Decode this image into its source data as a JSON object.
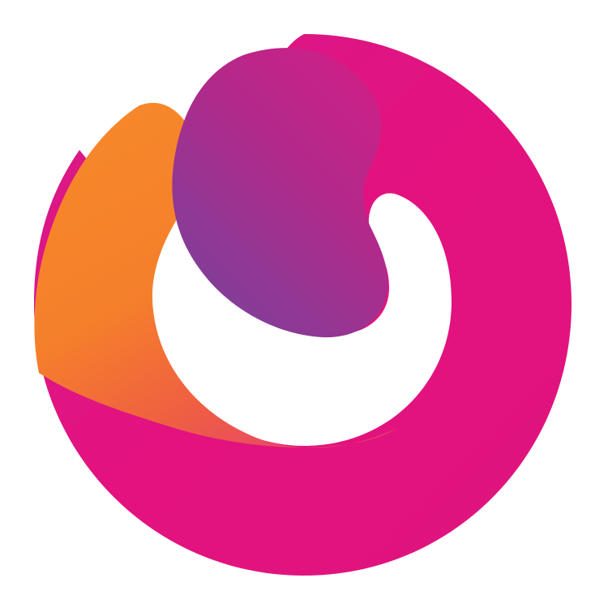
{
  "logo": {
    "icon": "swirl-logo-icon",
    "colors": {
      "background": "#ffffff",
      "magenta": "#e3127f",
      "pink": "#d41b86",
      "orange": "#f7882a",
      "orange_red": "#ef5f42",
      "purple": "#7f3f99",
      "violet": "#b02a8b"
    }
  }
}
